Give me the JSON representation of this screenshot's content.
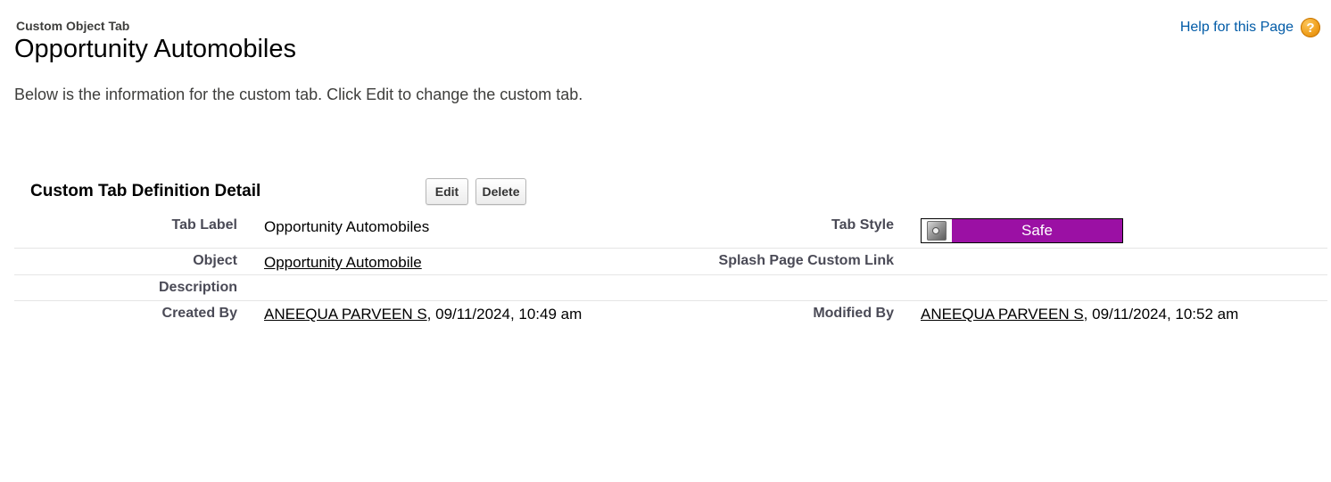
{
  "header": {
    "page_type": "Custom Object Tab",
    "title": "Opportunity Automobiles",
    "help_link": "Help for this Page",
    "help_icon": "question-mark-icon"
  },
  "description": "Below is the information for the custom tab. Click Edit to change the custom tab.",
  "detail": {
    "title": "Custom Tab Definition Detail",
    "buttons": {
      "edit": "Edit",
      "delete": "Delete"
    },
    "rows": [
      {
        "left_label": "Tab Label",
        "left_value": "Opportunity Automobiles",
        "right_label": "Tab Style",
        "right_value": {
          "icon": "safe-icon",
          "label": "Safe",
          "color": "#9b10a4"
        }
      },
      {
        "left_label": "Object",
        "left_value": "Opportunity Automobile",
        "right_label": "Splash Page Custom Link",
        "right_value": ""
      },
      {
        "left_label": "Description",
        "left_value": ""
      },
      {
        "left_label": "Created By",
        "left_user": "ANEEQUA PARVEEN S",
        "left_date": ", 09/11/2024, 10:49 am",
        "right_label": "Modified By",
        "right_user": "ANEEQUA PARVEEN S",
        "right_date": ", 09/11/2024, 10:52 am"
      }
    ]
  }
}
